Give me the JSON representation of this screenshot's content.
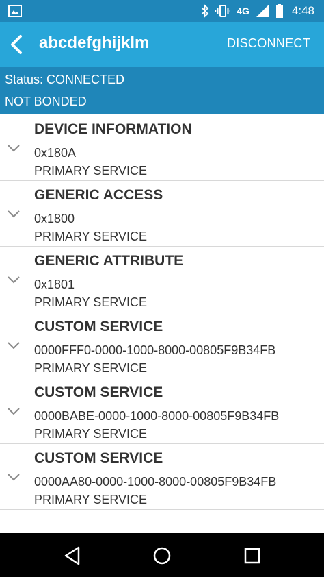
{
  "status_bar": {
    "network": "4G",
    "time": "4:48"
  },
  "app_bar": {
    "title": "abcdefghijklm",
    "action": "DISCONNECT"
  },
  "connection": {
    "status": "Status: CONNECTED",
    "bond": "NOT BONDED"
  },
  "services": [
    {
      "name": "DEVICE INFORMATION",
      "uuid": "0x180A",
      "type": "PRIMARY SERVICE"
    },
    {
      "name": "GENERIC ACCESS",
      "uuid": "0x1800",
      "type": "PRIMARY SERVICE"
    },
    {
      "name": "GENERIC ATTRIBUTE",
      "uuid": "0x1801",
      "type": "PRIMARY SERVICE"
    },
    {
      "name": "CUSTOM SERVICE",
      "uuid": "0000FFF0-0000-1000-8000-00805F9B34FB",
      "type": "PRIMARY SERVICE"
    },
    {
      "name": "CUSTOM SERVICE",
      "uuid": "0000BABE-0000-1000-8000-00805F9B34FB",
      "type": "PRIMARY SERVICE"
    },
    {
      "name": "CUSTOM SERVICE",
      "uuid": "0000AA80-0000-1000-8000-00805F9B34FB",
      "type": "PRIMARY SERVICE"
    }
  ],
  "colors": {
    "status_bar": "#1f86b9",
    "app_bar": "#28a6d9",
    "status_panel": "#1f86b9",
    "nav_bar": "#000000"
  }
}
